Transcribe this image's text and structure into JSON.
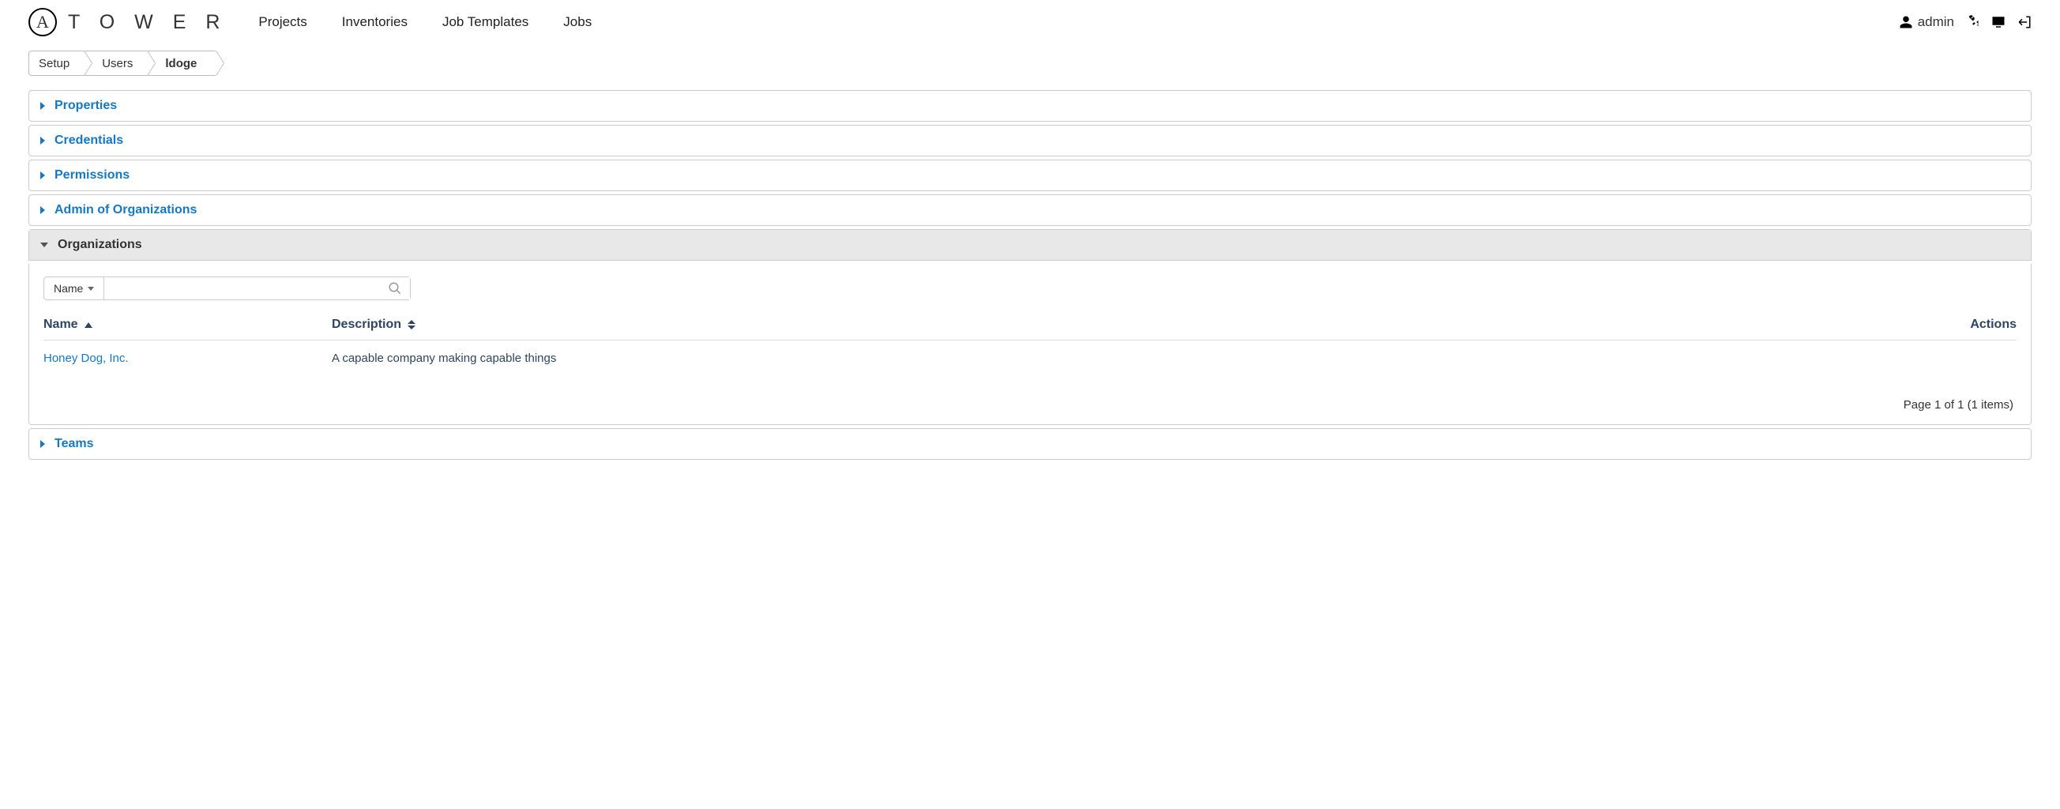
{
  "brand": {
    "logo_letter": "A",
    "name": "T O W E R"
  },
  "nav": {
    "items": [
      "Projects",
      "Inventories",
      "Job Templates",
      "Jobs"
    ]
  },
  "user": {
    "name": "admin"
  },
  "breadcrumb": {
    "items": [
      {
        "label": "Setup",
        "active": false
      },
      {
        "label": "Users",
        "active": false
      },
      {
        "label": "ldoge",
        "active": true
      }
    ]
  },
  "sections": {
    "properties": "Properties",
    "credentials": "Credentials",
    "permissions": "Permissions",
    "admin_orgs": "Admin of Organizations",
    "organizations": "Organizations",
    "teams": "Teams"
  },
  "search": {
    "filter_label": "Name",
    "value": ""
  },
  "table": {
    "columns": {
      "name": "Name",
      "description": "Description",
      "actions": "Actions"
    },
    "rows": [
      {
        "name": "Honey Dog, Inc.",
        "description": "A capable company making capable things"
      }
    ]
  },
  "pagination": "Page 1 of 1 (1 items)"
}
